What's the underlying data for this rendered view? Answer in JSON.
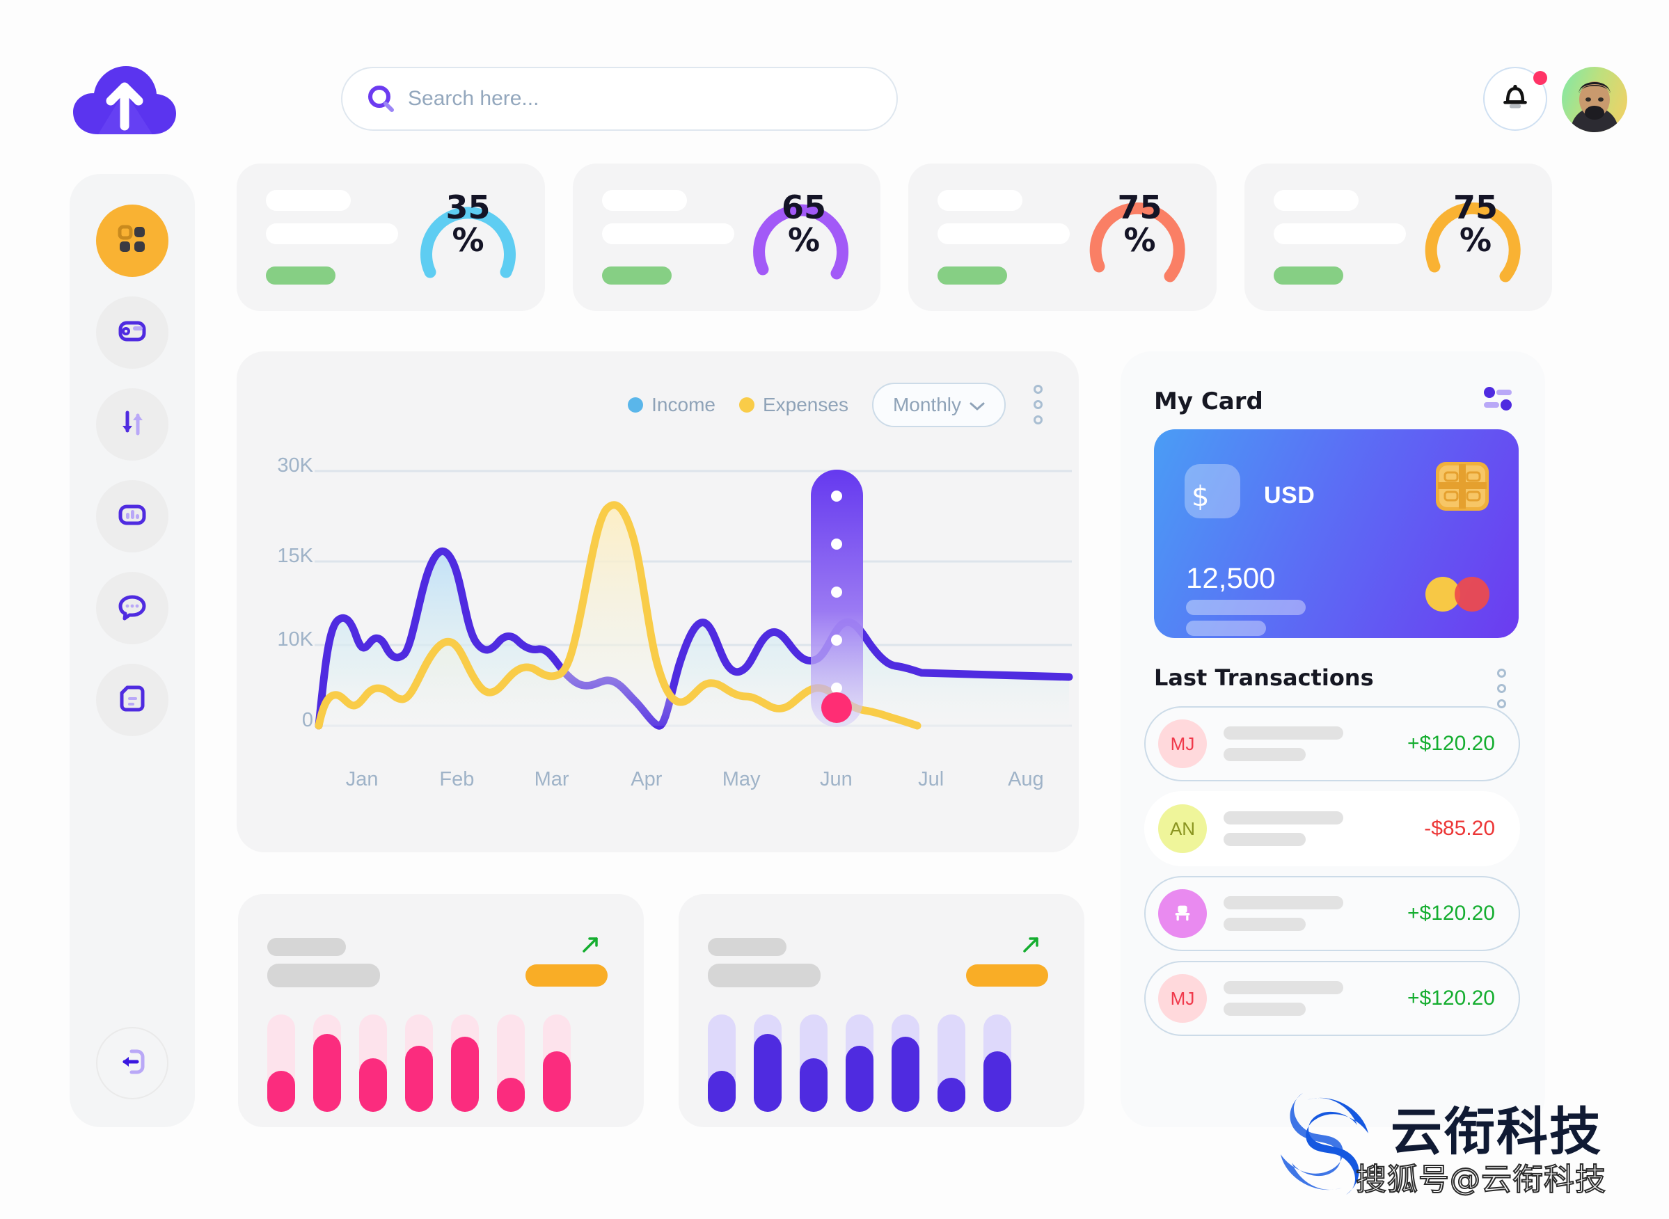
{
  "search": {
    "placeholder": "Search here...",
    "value": "",
    "icon": "search-icon"
  },
  "header": {
    "logo_icon": "cloud-upload-icon",
    "bell_icon": "bell-icon",
    "avatar_label": "user-avatar"
  },
  "sidebar": {
    "items": [
      {
        "icon": "grid-dashboard-icon",
        "name": "dashboard",
        "active": true
      },
      {
        "icon": "wallet-icon",
        "name": "wallet",
        "active": false
      },
      {
        "icon": "transfer-arrows-icon",
        "name": "transfers",
        "active": false
      },
      {
        "icon": "bar-chart-icon",
        "name": "statistics",
        "active": false
      },
      {
        "icon": "chat-bubble-icon",
        "name": "messages",
        "active": false
      },
      {
        "icon": "document-icon",
        "name": "documents",
        "active": false
      }
    ],
    "logout": {
      "icon": "logout-icon",
      "name": "logout"
    }
  },
  "kpi_cards": [
    {
      "value": "35",
      "unit": "%",
      "percent": 35,
      "color": "#5ecdf2",
      "track": "#f4f4f5"
    },
    {
      "value": "65",
      "unit": "%",
      "percent": 65,
      "color": "#a259f7",
      "track": "#f4f4f5"
    },
    {
      "value": "75",
      "unit": "%",
      "percent": 75,
      "color": "#fa7f65",
      "track": "#f4f4f5"
    },
    {
      "value": "75",
      "unit": "%",
      "percent": 75,
      "color": "#f9b233",
      "track": "#f4f4f5"
    }
  ],
  "chart_header": {
    "legend": [
      {
        "label": "Income",
        "color": "#5ab6ea"
      },
      {
        "label": "Expenses",
        "color": "#f9cc48"
      }
    ],
    "period": "Monthly",
    "period_caret": "chevron-down-icon",
    "menu_icon": "kebab-menu-icon"
  },
  "chart_data": {
    "type": "area",
    "title": "",
    "xlabel": "",
    "ylabel": "",
    "categories": [
      "Jan",
      "Feb",
      "Mar",
      "Apr",
      "May",
      "Jun",
      "Jul",
      "Aug"
    ],
    "ytick_labels": [
      "30K",
      "15K",
      "10K",
      "0"
    ],
    "ytick_values": [
      30000,
      15000,
      10000,
      0
    ],
    "ylim": [
      0,
      30000
    ],
    "grid": true,
    "legend_position": "top-right",
    "series": [
      {
        "name": "Income",
        "line_color": "#4f2be0",
        "fill_color": "#cfe6f7",
        "values": [
          0,
          11800,
          10600,
          11300,
          9900,
          16200,
          10400,
          10900,
          11100,
          9200,
          11400,
          8600,
          8300,
          5900,
          11900,
          9700,
          10100,
          11500,
          9500,
          8900
        ]
      },
      {
        "name": "Expenses",
        "line_color": "#f9cc48",
        "fill_color": "#fdf3d6",
        "values": [
          0,
          5200,
          4300,
          6000,
          5700,
          10600,
          9100,
          7800,
          10100,
          9700,
          28800,
          14600,
          8700,
          9200,
          8200,
          6300,
          11300,
          9600,
          7900,
          3600
        ]
      }
    ],
    "annotations": [
      {
        "type": "highlight-bar",
        "at_category": "Jul",
        "color_top": "#6539ef",
        "color_bottom": "#cfc6f6",
        "dots": 5
      },
      {
        "type": "marker",
        "at_category": "Jul",
        "value": 10000,
        "color": "#ff2d74"
      }
    ]
  },
  "my_card": {
    "title": "My Card",
    "filter_icon": "sliders-icon",
    "currency_symbol": "$",
    "currency": "USD",
    "amount": "12,500",
    "chip_icon": "emv-chip-icon",
    "network_icon": "mastercard-icon"
  },
  "transactions": {
    "title": "Last Transactions",
    "menu_icon": "kebab-menu-icon",
    "items": [
      {
        "initials": "MJ",
        "avatar_bg": "#ffd9dc",
        "avatar_fg": "#f0394b",
        "avatar_icon": "",
        "amount": "+$120.20",
        "amount_color": "#14ad2f",
        "style": "outlined"
      },
      {
        "initials": "AN",
        "avatar_bg": "#eff59a",
        "avatar_fg": "#8a9420",
        "avatar_icon": "",
        "amount": "-$85.20",
        "amount_color": "#ec3636",
        "style": "plain"
      },
      {
        "initials": "",
        "avatar_bg": "#e98af0",
        "avatar_fg": "#ffffff",
        "avatar_icon": "chair-icon",
        "amount": "+$120.20",
        "amount_color": "#14ad2f",
        "style": "outlined"
      },
      {
        "initials": "MJ",
        "avatar_bg": "#ffd9dc",
        "avatar_fg": "#f0394b",
        "avatar_icon": "",
        "amount": "+$120.20",
        "amount_color": "#14ad2f",
        "style": "outlined"
      }
    ]
  },
  "mini_charts": [
    {
      "name": "pink-bars-card",
      "trend_icon": "trend-up-arrow-icon",
      "pill_color": "#f9ad26",
      "track_color": "#fde3ec",
      "fill_color": "#fb2c7e",
      "type": "bar",
      "values": [
        42,
        80,
        55,
        68,
        77,
        35,
        62
      ],
      "ylim": [
        0,
        100
      ]
    },
    {
      "name": "purple-bars-card",
      "trend_icon": "trend-up-arrow-icon",
      "pill_color": "#f9ad26",
      "track_color": "#ded9fb",
      "fill_color": "#4f2be0",
      "type": "bar",
      "values": [
        42,
        80,
        55,
        68,
        77,
        35,
        62
      ],
      "ylim": [
        0,
        100
      ]
    }
  ],
  "watermark": {
    "brand": "云衔科技",
    "handle": "搜狐号@云衔科技"
  }
}
